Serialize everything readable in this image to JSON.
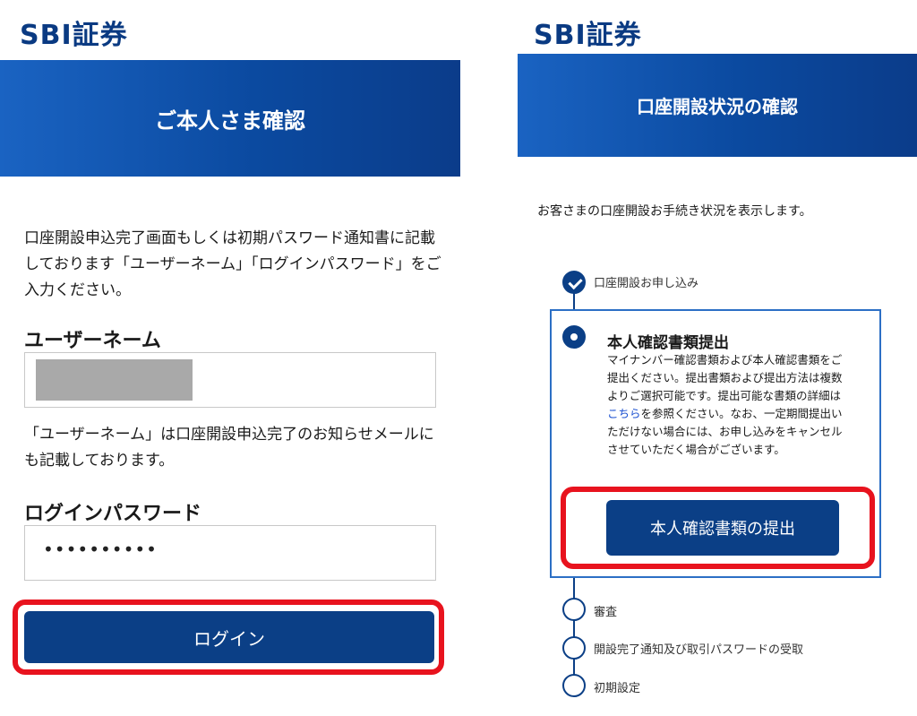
{
  "left": {
    "logo": "SBI証券",
    "header_title": "ご本人さま確認",
    "intro_text": "口座開設申込完了画面もしくは初期パスワード通知書に記載しております「ユーザーネーム」「ログインパスワード」をご入力ください。",
    "username": {
      "title": "ユーザーネーム",
      "hint": "「ユーザーネーム」は口座開設申込完了のお知らせメールにも記載しております。"
    },
    "password": {
      "title": "ログインパスワード",
      "value": "••••••••••"
    },
    "login_button": "ログイン"
  },
  "right": {
    "logo": "SBI証券",
    "header_title": "口座開設状況の確認",
    "description": "お客さまの口座開設お手続き状況を表示します。",
    "steps": [
      {
        "label": "口座開設お申し込み",
        "status": "done"
      },
      {
        "label": "本人確認書類提出",
        "status": "active",
        "body_before_link": "マイナンバー確認書類および本人確認書類をご提出ください。提出書類および提出方法は複数よりご選択可能です。提出可能な書類の詳細は",
        "link_text": "こちら",
        "body_after_link": "を参照ください。なお、一定期間提出いただけない場合には、お申し込みをキャンセルさせていただく場合がございます。",
        "button": "本人確認書類の提出"
      },
      {
        "label": "審査",
        "status": "pending"
      },
      {
        "label": "開設完了通知及び取引パスワードの受取",
        "status": "pending"
      },
      {
        "label": "初期設定",
        "status": "pending"
      }
    ]
  },
  "colors": {
    "brand_blue": "#0b3f86",
    "banner_start": "#1a63c2",
    "highlight_red": "#e8131e",
    "link_blue": "#1a4fd0"
  }
}
